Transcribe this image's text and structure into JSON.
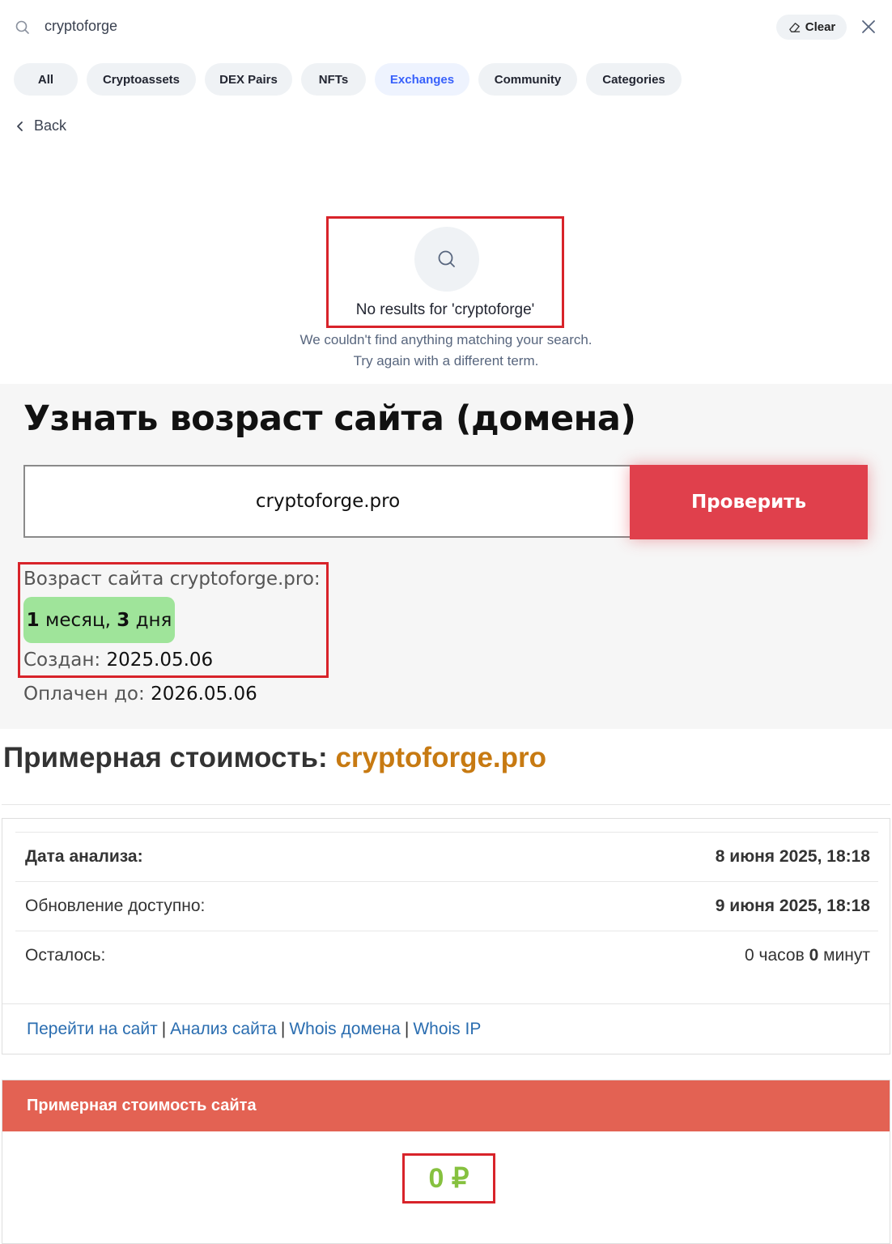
{
  "search": {
    "query": "cryptoforge",
    "clear_label": "Clear",
    "tabs": [
      {
        "label": "All"
      },
      {
        "label": "Cryptoassets"
      },
      {
        "label": "DEX Pairs"
      },
      {
        "label": "NFTs"
      },
      {
        "label": "Exchanges",
        "active": true
      },
      {
        "label": "Community"
      },
      {
        "label": "Categories"
      }
    ],
    "back_label": "Back",
    "no_results": "No results for 'cryptoforge'",
    "sub_line1": "We couldn't find anything matching your search.",
    "sub_line2": "Try again with a different term.",
    "accent_color": "#3861fb"
  },
  "age": {
    "title": "Узнать возраст сайта (домена)",
    "domain_value": "cryptoforge.pro",
    "check_button": "Проверить",
    "age_label": "Возраст сайта cryptoforge.pro:",
    "age_months_num": "1",
    "age_months_word": "месяц,",
    "age_days_num": "3",
    "age_days_word": "дня",
    "created_label": "Создан:",
    "created_value": "2025.05.06",
    "paid_label": "Оплачен до:",
    "paid_value": "2026.05.06",
    "button_color": "#e0404c",
    "badge_color": "#9fe49a"
  },
  "value": {
    "title_prefix": "Примерная стоимость:",
    "title_domain": "cryptoforge.pro",
    "analysis_date_label": "Дата анализа:",
    "analysis_date_value": "8 июня 2025, 18:18",
    "update_label": "Обновление доступно:",
    "update_value": "9 июня 2025, 18:18",
    "remaining_label": "Осталось:",
    "remaining_hours_num": "0",
    "remaining_hours_word": "часов",
    "remaining_minutes_num": "0",
    "remaining_minutes_word": "минут",
    "links": [
      "Перейти на сайт",
      "Анализ сайта",
      "Whois домена",
      "Whois IP"
    ],
    "cost_header": "Примерная стоимость сайта",
    "cost_value": "0 ₽",
    "header_color": "#e36253",
    "cost_color": "#86c13f",
    "domain_color": "#c77a12"
  }
}
